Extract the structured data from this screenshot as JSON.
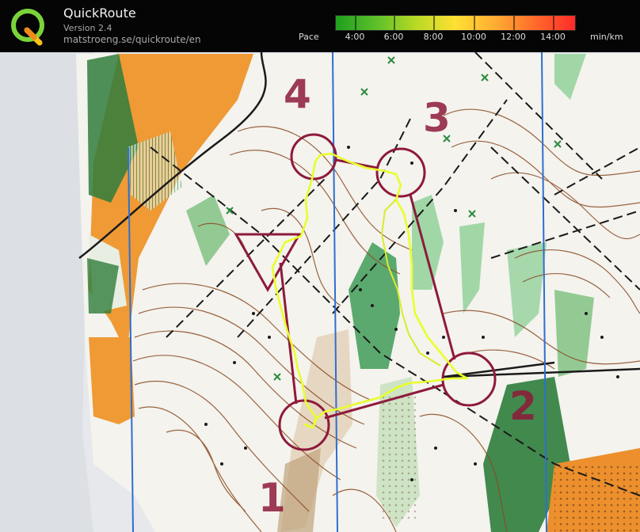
{
  "app": {
    "name": "QuickRoute",
    "version": "Version 2.4",
    "url": "matstroeng.se/quickroute/en",
    "logo_letter": "Q"
  },
  "pace_scale": {
    "label": "Pace",
    "unit": "min/km",
    "ticks": [
      "4:00",
      "6:00",
      "8:00",
      "10:00",
      "12:00",
      "14:00"
    ],
    "gradient_colors": [
      "#1f9e1f",
      "#5cbf2a",
      "#b7d925",
      "#ffe033",
      "#ffad33",
      "#ff6a2a",
      "#ff2a2a"
    ]
  },
  "map": {
    "control_numbers": [
      "4",
      "3",
      "2",
      "1"
    ],
    "course_color": "#8e1a3a",
    "route_color": "#e8ff2a"
  }
}
